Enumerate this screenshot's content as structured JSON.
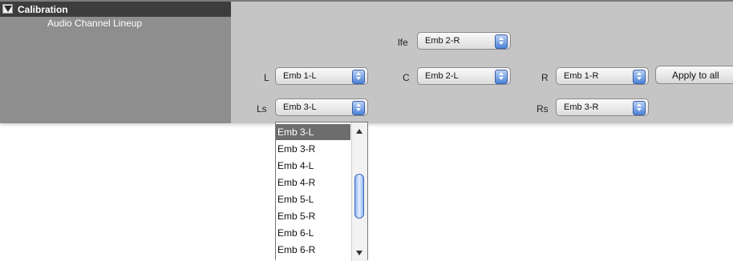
{
  "sidebar": {
    "header": {
      "title": "Calibration"
    },
    "items": [
      {
        "label": "Audio Channel Lineup"
      }
    ]
  },
  "channels": {
    "lfe": {
      "label": "lfe",
      "value": "Emb 2-R"
    },
    "l": {
      "label": "L",
      "value": "Emb 1-L"
    },
    "c": {
      "label": "C",
      "value": "Emb 2-L"
    },
    "r": {
      "label": "R",
      "value": "Emb 1-R"
    },
    "ls": {
      "label": "Ls",
      "value": "Emb 3-L"
    },
    "rs": {
      "label": "Rs",
      "value": "Emb 3-R"
    }
  },
  "apply_button": {
    "label": "Apply to all"
  },
  "dropdown": {
    "options": [
      "Emb 3-L",
      "Emb 3-R",
      "Emb 4-L",
      "Emb 4-R",
      "Emb 5-L",
      "Emb 5-R",
      "Emb 6-L",
      "Emb 6-R"
    ],
    "selected": "Emb 3-L"
  },
  "colors": {
    "accent": "#4c83d8",
    "header_bg": "#3d3d3d",
    "sidebar_bg": "#8e8e8e",
    "panel_bg": "#c5c5c5"
  }
}
